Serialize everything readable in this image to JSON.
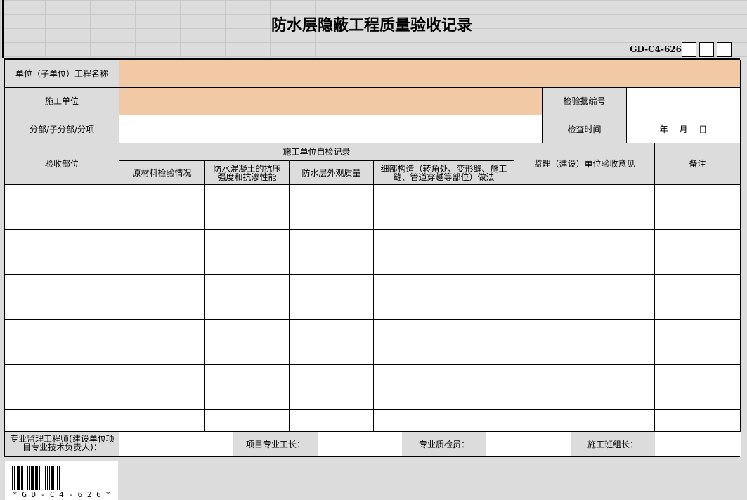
{
  "title": "防水层隐蔽工程质量验收记录",
  "form_code": "GD-C4-626",
  "header": {
    "unit_project_name_label": "单位（子单位）工程名称",
    "unit_project_name_value": "",
    "construction_unit_label": "施工单位",
    "construction_unit_value": "",
    "batch_no_label": "检验批编号",
    "batch_no_value": "",
    "division_label": "分部/子分部/分项",
    "division_value": "",
    "inspection_time_label": "检查时间",
    "inspection_time_value": "年　 月　 日"
  },
  "table": {
    "col_location": "验收部位",
    "group_self_check": "施工单位自检记录",
    "col_raw_material": "原材料检验情况",
    "col_concrete": "防水混凝土的抗压强度和抗渗性能",
    "col_appearance": "防水层外观质量",
    "col_details": "细部构造（转角处、变形缝、施工缝、管道穿越等部位）做法",
    "col_supervision": "监理（建设）单位验收意见",
    "col_remarks": "备注",
    "rows": [
      [
        "",
        "",
        "",
        "",
        "",
        "",
        ""
      ],
      [
        "",
        "",
        "",
        "",
        "",
        "",
        ""
      ],
      [
        "",
        "",
        "",
        "",
        "",
        "",
        ""
      ],
      [
        "",
        "",
        "",
        "",
        "",
        "",
        ""
      ],
      [
        "",
        "",
        "",
        "",
        "",
        "",
        ""
      ],
      [
        "",
        "",
        "",
        "",
        "",
        "",
        ""
      ],
      [
        "",
        "",
        "",
        "",
        "",
        "",
        ""
      ],
      [
        "",
        "",
        "",
        "",
        "",
        "",
        ""
      ],
      [
        "",
        "",
        "",
        "",
        "",
        "",
        ""
      ],
      [
        "",
        "",
        "",
        "",
        "",
        "",
        ""
      ],
      [
        "",
        "",
        "",
        "",
        "",
        "",
        ""
      ]
    ]
  },
  "signatures": {
    "engineer_label": "专业监理工程师(建设单位项目专业技术负责人)：",
    "foreman_label": "项目专业工长：",
    "quality_inspector_label": "专业质检员：",
    "team_leader_label": "施工班组长："
  },
  "barcode": {
    "text": "* G D - C 4 - 6 2 6 *"
  }
}
